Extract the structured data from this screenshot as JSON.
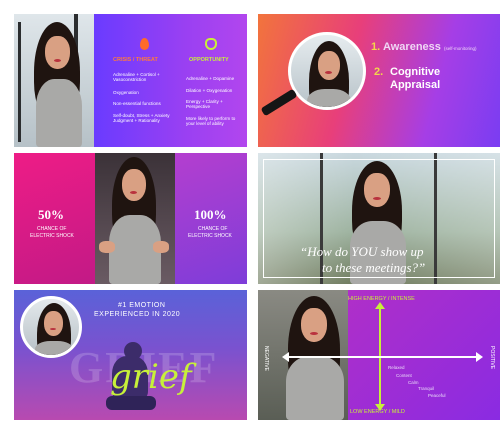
{
  "slides": {
    "s1": {
      "left_heading": "CRISIS / THREAT",
      "right_heading": "OPPORTUNITY",
      "left_items": [
        "Adrenaline + Cortisol + Vasoconstriction",
        "Oxygenation",
        "Non-essential functions",
        "Self-doubt, Stress + Anxiety Judgment + Rationality"
      ],
      "right_items": [
        "Adrenaline + Dopamine",
        "Dilation + Oxygenation",
        "Energy + Clarity + Perspective",
        "More likely to perform to your level of ability"
      ]
    },
    "s2": {
      "item1_num": "1.",
      "item1_label": "Awareness",
      "item1_note": "(self-monitoring)",
      "item2_num": "2.",
      "item2_label_line1": "Cognitive",
      "item2_label_line2": "Appraisal"
    },
    "s3": {
      "left_pct": "50%",
      "left_caption_1": "CHANCE OF",
      "left_caption_2": "ELECTRIC SHOCK",
      "right_pct": "100%",
      "right_caption_1": "CHANCE OF",
      "right_caption_2": "ELECTRIC SHOCK"
    },
    "s4": {
      "quote_line1": "“How do YOU show up",
      "quote_line2": "to these meetings?”"
    },
    "s5": {
      "title_line1": "#1 EMOTION",
      "title_line2": "EXPERIENCED IN 2020",
      "bg_word": "GRIEF",
      "script_word": "grief"
    },
    "s6": {
      "top_label": "HIGH ENERGY / INTENSE",
      "bottom_label": "LOW ENERGY / MILD",
      "left_label": "NEGATIVE",
      "right_label": "POSITIVE",
      "words": [
        "Relaxed",
        "Content",
        "Calm",
        "Tranquil",
        "Peaceful"
      ]
    }
  },
  "colors": {
    "purple": "#8a2be2",
    "magenta": "#e0117f",
    "orange": "#f2743c",
    "yellow_green": "#c7f03a",
    "pink_arrow": "#ff3b3b"
  }
}
